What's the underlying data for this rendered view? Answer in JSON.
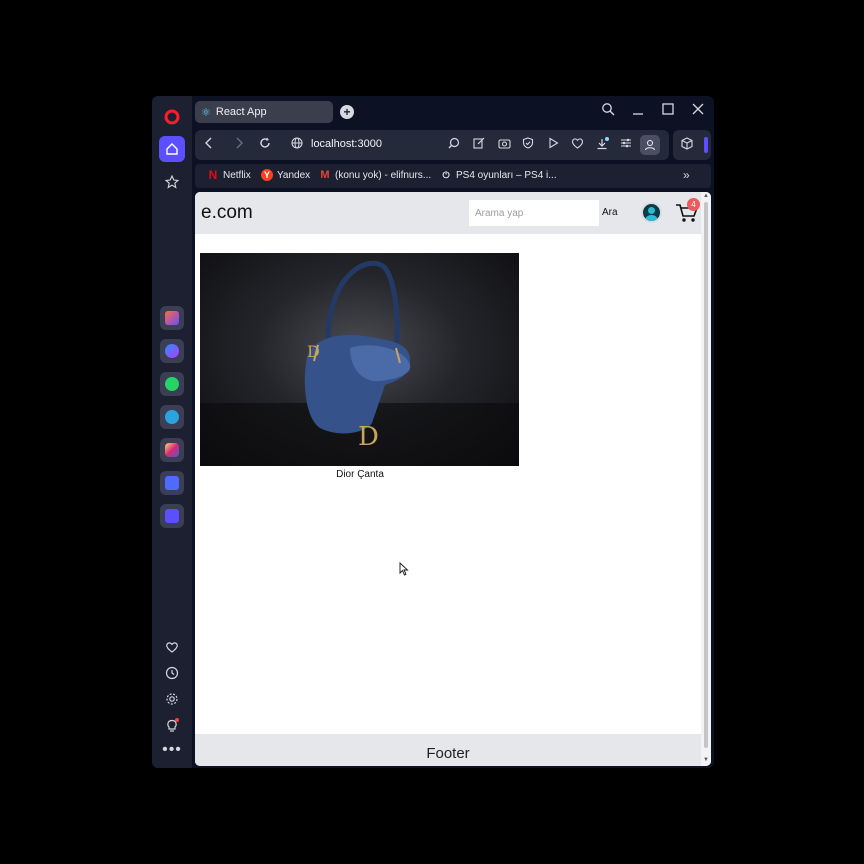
{
  "browser": {
    "tab_title": "React App",
    "url": "localhost:3000",
    "bookmarks": [
      {
        "label": "Netflix",
        "icon": "netflix-icon"
      },
      {
        "label": "Yandex",
        "icon": "yandex-icon"
      },
      {
        "label": "(konu yok) - elifnurs...",
        "icon": "gmail-icon"
      },
      {
        "label": "PS4 oyunları – PS4 i...",
        "icon": "playstation-icon"
      }
    ],
    "colors": {
      "accent": "#5b4fff",
      "chrome_bg": "#0c1123",
      "sidebar_bg": "#1c2030"
    }
  },
  "app": {
    "logo": "e.com",
    "search_placeholder": "Arama yap",
    "search_button": "Ara",
    "cart_count": "4",
    "products": [
      {
        "name": "Dior Çanta"
      }
    ],
    "footer": "Footer"
  }
}
